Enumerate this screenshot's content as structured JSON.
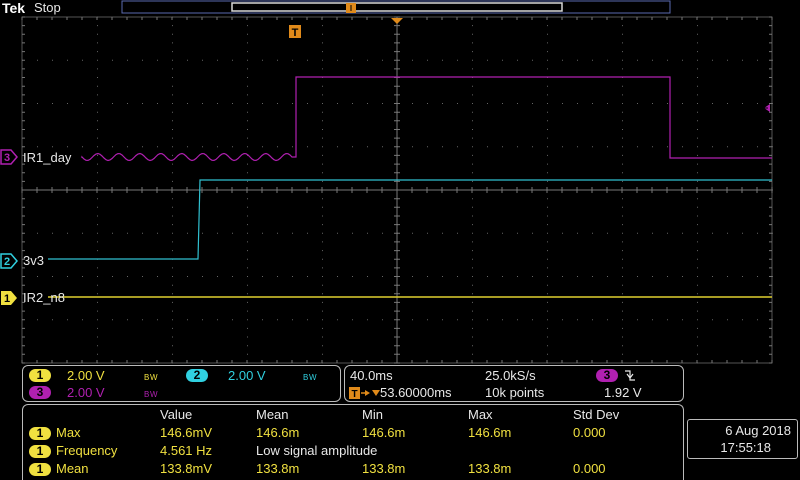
{
  "header": {
    "brand": "Tek",
    "status": "Stop",
    "trigger_marker": "T"
  },
  "channels": [
    {
      "num": "1",
      "label": "IR2_n8",
      "color": "#f0e040",
      "scale": "2.00 V",
      "bw": "B W"
    },
    {
      "num": "2",
      "label": "3v3",
      "color": "#30d0e0",
      "scale": "2.00 V",
      "bw": "B W"
    },
    {
      "num": "3",
      "label": "IR1_day",
      "color": "#b020b0",
      "scale": "2.00 V",
      "bw": "B W"
    }
  ],
  "timebase": {
    "scale": "40.0ms",
    "sample_rate": "25.0kS/s",
    "trigger_delay": "53.60000ms",
    "record_length": "10k points",
    "trigger_channel": "3",
    "trigger_slope_icon": "falling-edge-icon",
    "trigger_level": "1.92 V"
  },
  "measurements": {
    "headers": [
      "Value",
      "Mean",
      "Min",
      "Max",
      "Std Dev"
    ],
    "rows": [
      {
        "ch": "1",
        "name": "Max",
        "value": "146.6mV",
        "mean": "146.6m",
        "min": "146.6m",
        "max": "146.6m",
        "std": "0.000"
      },
      {
        "ch": "1",
        "name": "Frequency",
        "value": "4.561 Hz",
        "mean": "Low signal amplitude",
        "min": "",
        "max": "",
        "std": ""
      },
      {
        "ch": "1",
        "name": "Mean",
        "value": "133.8mV",
        "mean": "133.8m",
        "min": "133.8m",
        "max": "133.8m",
        "std": "0.000"
      }
    ]
  },
  "datetime": {
    "date": "6 Aug 2018",
    "time": "17:55:18"
  }
}
